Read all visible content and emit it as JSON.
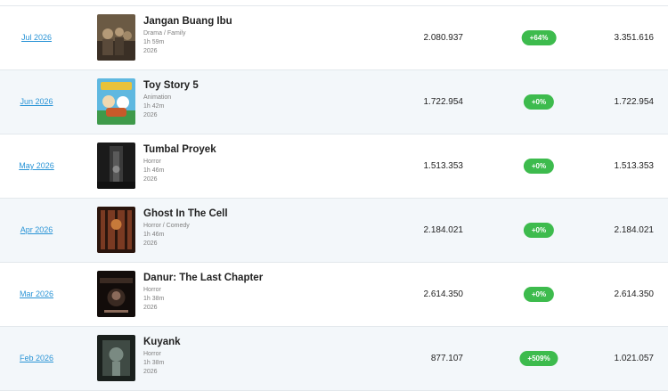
{
  "rows": [
    {
      "month": "Jul 2026",
      "title": "Jangan Buang Ibu",
      "genre": "Drama / Family",
      "duration": "1h 59m",
      "year": "2026",
      "viewers": "2.080.937",
      "change": "+64%",
      "total": "3.351.616",
      "poster_colors": [
        "#6b5a44",
        "#3a2f25",
        "#b49a78"
      ]
    },
    {
      "month": "Jun 2026",
      "title": "Toy Story 5",
      "genre": "Animation",
      "duration": "1h 42m",
      "year": "2026",
      "viewers": "1.722.954",
      "change": "+0%",
      "total": "1.722.954",
      "poster_colors": [
        "#5fb8e0",
        "#e8c23a",
        "#3f9a4a"
      ]
    },
    {
      "month": "May 2026",
      "title": "Tumbal Proyek",
      "genre": "Horror",
      "duration": "1h 46m",
      "year": "2026",
      "viewers": "1.513.353",
      "change": "+0%",
      "total": "1.513.353",
      "poster_colors": [
        "#2b2b2b",
        "#111111",
        "#5a5a5a"
      ]
    },
    {
      "month": "Apr 2026",
      "title": "Ghost In The Cell",
      "genre": "Horror / Comedy",
      "duration": "1h 46m",
      "year": "2026",
      "viewers": "2.184.021",
      "change": "+0%",
      "total": "2.184.021",
      "poster_colors": [
        "#7a3a22",
        "#2a150d",
        "#c77a3a"
      ]
    },
    {
      "month": "Mar 2026",
      "title": "Danur: The Last Chapter",
      "genre": "Horror",
      "duration": "1h 38m",
      "year": "2026",
      "viewers": "2.614.350",
      "change": "+0%",
      "total": "2.614.350",
      "poster_colors": [
        "#3a2a22",
        "#120c0a",
        "#8a6a5a"
      ]
    },
    {
      "month": "Feb 2026",
      "title": "Kuyank",
      "genre": "Horror",
      "duration": "1h 38m",
      "year": "2026",
      "viewers": "877.107",
      "change": "+509%",
      "total": "1.021.057",
      "poster_colors": [
        "#3f4a44",
        "#1a201d",
        "#7a8a82"
      ]
    }
  ],
  "colors": {
    "link": "#2a94d6",
    "badge": "#3dbb4d",
    "alt_row": "#f3f7fa",
    "border": "#e3e8ec"
  }
}
